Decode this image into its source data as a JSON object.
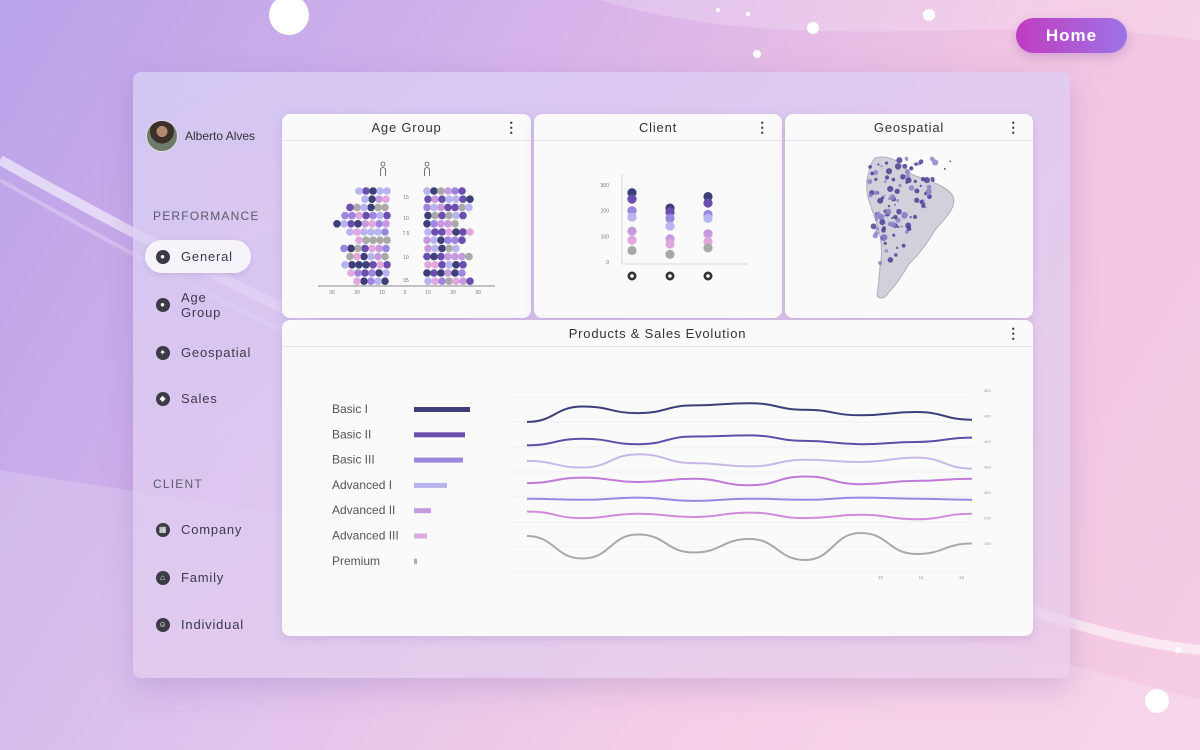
{
  "home_label": "Home",
  "user": {
    "name": "Alberto Alves"
  },
  "nav": {
    "performance_title": "PERFORMANCE",
    "performance_items": [
      {
        "label": "General",
        "icon": "bag-icon",
        "active": true
      },
      {
        "label": "Age Group",
        "icon": "person-icon",
        "active": false
      },
      {
        "label": "Geospatial",
        "icon": "leaf-icon",
        "active": false
      },
      {
        "label": "Sales",
        "icon": "tag-icon",
        "active": false
      }
    ],
    "client_title": "CLIENT",
    "client_items": [
      {
        "label": "Company",
        "icon": "building-icon"
      },
      {
        "label": "Family",
        "icon": "house-icon"
      },
      {
        "label": "Individual",
        "icon": "smiley-icon"
      }
    ]
  },
  "cards": {
    "age_group": {
      "title": "Age Group"
    },
    "client": {
      "title": "Client"
    },
    "geospatial": {
      "title": "Geospatial"
    },
    "products": {
      "title": "Products & Sales Evolution"
    }
  },
  "colors": {
    "palette": [
      "#3d3f78",
      "#6a4fb0",
      "#9c86e0",
      "#b7b4f0",
      "#c79ae0",
      "#e0a8dd",
      "#a9a9a9"
    ],
    "accent": "#c13cbf"
  },
  "chart_data": [
    {
      "type": "scatter",
      "title": "Age Group",
      "left_ticks": [
        "30",
        "20",
        "10"
      ],
      "center_tick": "0",
      "right_ticks": [
        "10",
        "20",
        "30"
      ],
      "mid_labels": [
        "15",
        "10",
        "7.5",
        "10",
        "05"
      ],
      "legend_icons": [
        "male-icon",
        "female-icon"
      ]
    },
    {
      "type": "scatter",
      "title": "Client",
      "y_ticks": [
        "300",
        "200",
        "100",
        "0"
      ],
      "categories": [
        "company-icon",
        "family-icon",
        "individual-icon"
      ],
      "series": [
        {
          "values": [
            270,
            210,
            255
          ]
        },
        {
          "values": [
            245,
            195,
            230
          ]
        },
        {
          "values": [
            200,
            170,
            185
          ]
        },
        {
          "values": [
            175,
            140,
            170
          ]
        },
        {
          "values": [
            120,
            90,
            110
          ]
        },
        {
          "values": [
            85,
            70,
            80
          ]
        },
        {
          "values": [
            45,
            30,
            55
          ]
        }
      ]
    },
    {
      "type": "bar",
      "title": "Products & Sales Evolution",
      "categories": [
        "Basic I",
        "Basic II",
        "Basic III",
        "Advanced I",
        "Advanced II",
        "Advanced III",
        "Premium"
      ],
      "values": [
        56,
        51,
        49,
        33,
        17,
        13,
        3
      ],
      "right_axis_ticks": [
        "300",
        "400",
        "400",
        "400",
        "300",
        "200",
        "100"
      ],
      "x_ticks": [
        "",
        "",
        "",
        "",
        "",
        "",
        "",
        "",
        "",
        "10",
        "11",
        "12"
      ],
      "lines": [
        {
          "values": [
            18,
            4,
            10,
            3,
            1,
            7,
            12,
            9,
            16
          ]
        },
        {
          "values": [
            12,
            6,
            11,
            4,
            3,
            8,
            11,
            9,
            5
          ]
        },
        {
          "values": [
            8,
            14,
            2,
            10,
            13,
            7,
            9,
            5,
            15
          ]
        },
        {
          "values": [
            10,
            5,
            9,
            6,
            12,
            4,
            11,
            8,
            6
          ]
        },
        {
          "values": [
            6,
            7,
            5,
            8,
            6,
            7,
            5,
            6,
            7
          ]
        },
        {
          "values": [
            4,
            10,
            6,
            9,
            5,
            10,
            7,
            11,
            6
          ]
        },
        {
          "values": [
            3,
            18,
            2,
            14,
            5,
            19,
            1,
            15,
            8
          ]
        }
      ]
    }
  ]
}
